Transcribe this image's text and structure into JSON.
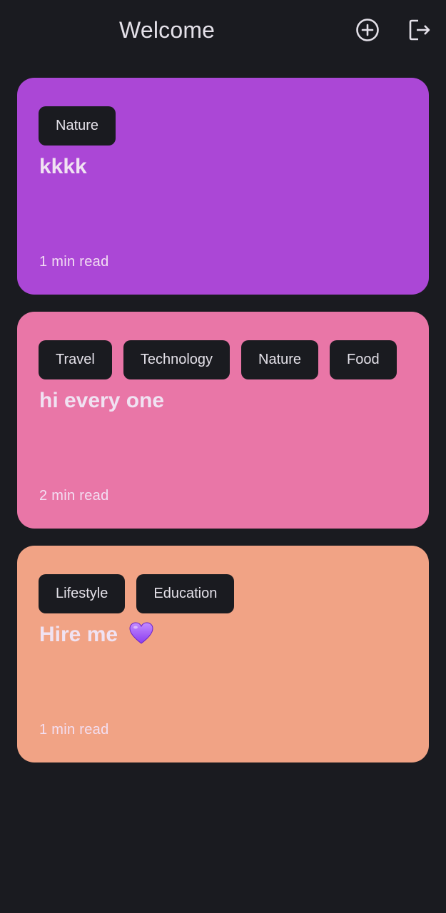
{
  "header": {
    "title": "Welcome",
    "add_icon": "add-circle-icon",
    "logout_icon": "logout-icon"
  },
  "posts": [
    {
      "color": "#ab47d6",
      "tags": [
        "Nature"
      ],
      "title": "kkkk",
      "read_time": "1 min read"
    },
    {
      "color": "#e976a7",
      "tags": [
        "Travel",
        "Technology",
        "Nature",
        "Food"
      ],
      "title": "hi every one",
      "read_time": "2 min read"
    },
    {
      "color": "#f1a385",
      "tags": [
        "Lifestyle",
        "Education"
      ],
      "title": "Hire me",
      "title_emoji": "purple-heart-icon",
      "read_time": "1 min read"
    }
  ],
  "colors": {
    "background": "#1a1b20",
    "chip_background": "#1a1b20",
    "on_surface": "#e4e1e9"
  }
}
